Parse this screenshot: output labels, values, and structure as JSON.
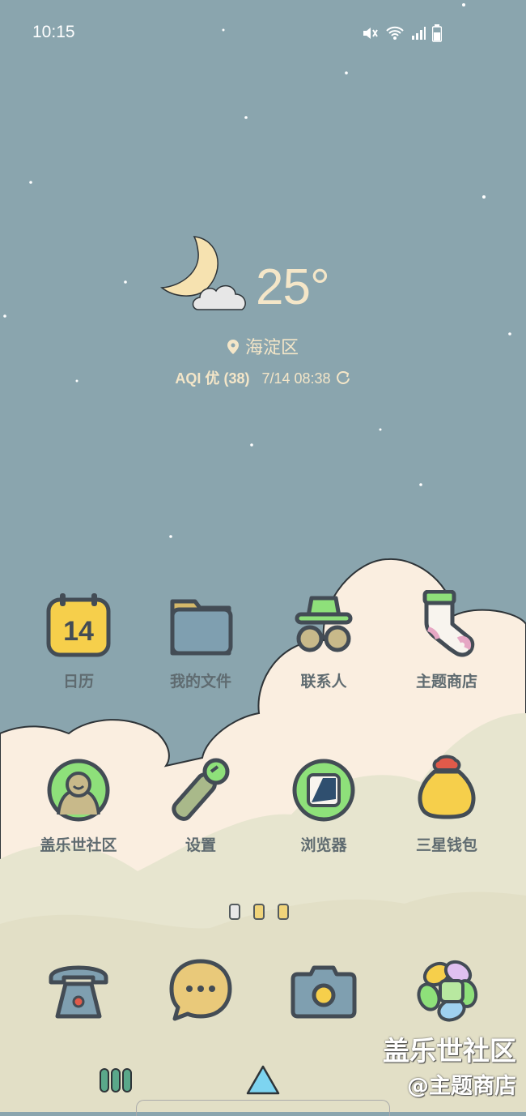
{
  "status_bar": {
    "time": "10:15",
    "icons": [
      "mute-icon",
      "wifi-icon",
      "signal-icon",
      "battery-icon"
    ]
  },
  "weather": {
    "temperature": "25°",
    "location": "海淀区",
    "aqi_label": "AQI 优",
    "aqi_value": "(38)",
    "updated": "7/14 08:38"
  },
  "apps": [
    {
      "label": "日历",
      "badge": "14",
      "icon": "calendar-icon"
    },
    {
      "label": "我的文件",
      "icon": "folder-icon"
    },
    {
      "label": "联系人",
      "icon": "contacts-icon"
    },
    {
      "label": "主题商店",
      "icon": "sock-icon"
    },
    {
      "label": "盖乐世社区",
      "icon": "community-icon"
    },
    {
      "label": "设置",
      "icon": "settings-icon"
    },
    {
      "label": "浏览器",
      "icon": "browser-icon"
    },
    {
      "label": "三星钱包",
      "icon": "wallet-icon"
    }
  ],
  "page_indicator": {
    "count": 3,
    "current": 0
  },
  "dock": [
    {
      "name": "phone",
      "icon": "phone-icon"
    },
    {
      "name": "messages",
      "icon": "message-icon"
    },
    {
      "name": "camera",
      "icon": "camera-icon"
    },
    {
      "name": "gallery",
      "icon": "gallery-icon"
    }
  ],
  "watermark": {
    "line1": "盖乐世社区",
    "line2": "@主题商店"
  },
  "nav": {
    "icons": [
      "recent-apps-icon",
      "home-icon"
    ]
  },
  "colors": {
    "sky": "#8aa5ae",
    "cloud": "#faeee0",
    "ground": "#e7e5cf",
    "accent_yellow": "#f6cf4b",
    "accent_green": "#8ee07a"
  }
}
